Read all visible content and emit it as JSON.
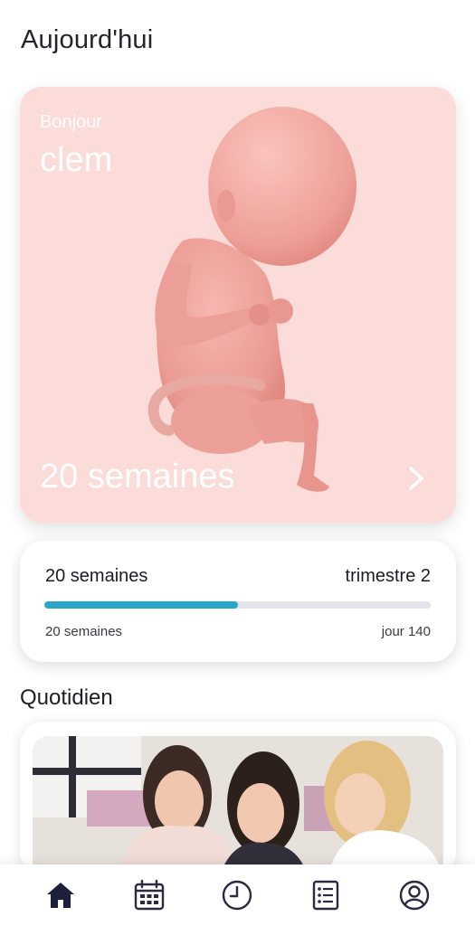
{
  "header": {
    "title": "Aujourd'hui"
  },
  "hero": {
    "greeting": "Bonjour",
    "name": "clem",
    "weeks_label": "20 semaines",
    "background_color": "#fbdcd9"
  },
  "progress": {
    "left_title": "20 semaines",
    "right_title": "trimestre 2",
    "fraction": 0.5,
    "left_caption": "20 semaines",
    "right_caption": "jour 140",
    "bar_color": "#2aa6c8"
  },
  "daily": {
    "section_title": "Quotidien"
  },
  "bottom_nav": {
    "items": [
      {
        "icon": "home-icon",
        "active": true
      },
      {
        "icon": "calendar-icon",
        "active": false
      },
      {
        "icon": "clock-icon",
        "active": false
      },
      {
        "icon": "checklist-icon",
        "active": false
      },
      {
        "icon": "profile-icon",
        "active": false
      }
    ]
  }
}
